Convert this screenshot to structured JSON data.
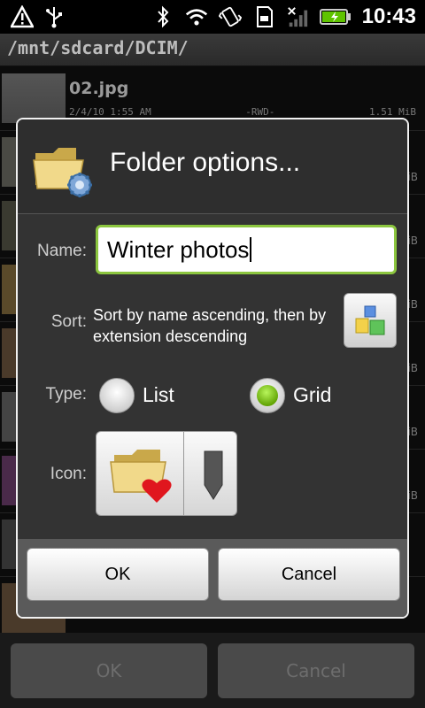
{
  "status_bar": {
    "time": "10:43",
    "icons": [
      "warning-icon",
      "usb-icon",
      "bluetooth-icon",
      "wifi-icon",
      "vibrate-icon",
      "sdcard-icon",
      "no-signal-icon",
      "battery-icon"
    ]
  },
  "path": "/mnt/sdcard/DCIM/",
  "background_list": {
    "first_item": {
      "name": "02.jpg",
      "date": "2/4/10 1:55 AM",
      "perm": "-RWD-",
      "size": "1.51 MiB"
    },
    "row_unit": "MiB"
  },
  "background_buttons": {
    "ok": "OK",
    "cancel": "Cancel"
  },
  "dialog": {
    "title": "Folder options...",
    "name_label": "Name:",
    "name_value": "Winter photos",
    "sort_label": "Sort:",
    "sort_text": "Sort by name ascending, then by extension descending",
    "type_label": "Type:",
    "type_options": [
      "List",
      "Grid"
    ],
    "type_selected": "Grid",
    "icon_label": "Icon:",
    "ok": "OK",
    "cancel": "Cancel"
  },
  "colors": {
    "accent_green": "#8cc63f",
    "dialog_bg": "#333333"
  }
}
